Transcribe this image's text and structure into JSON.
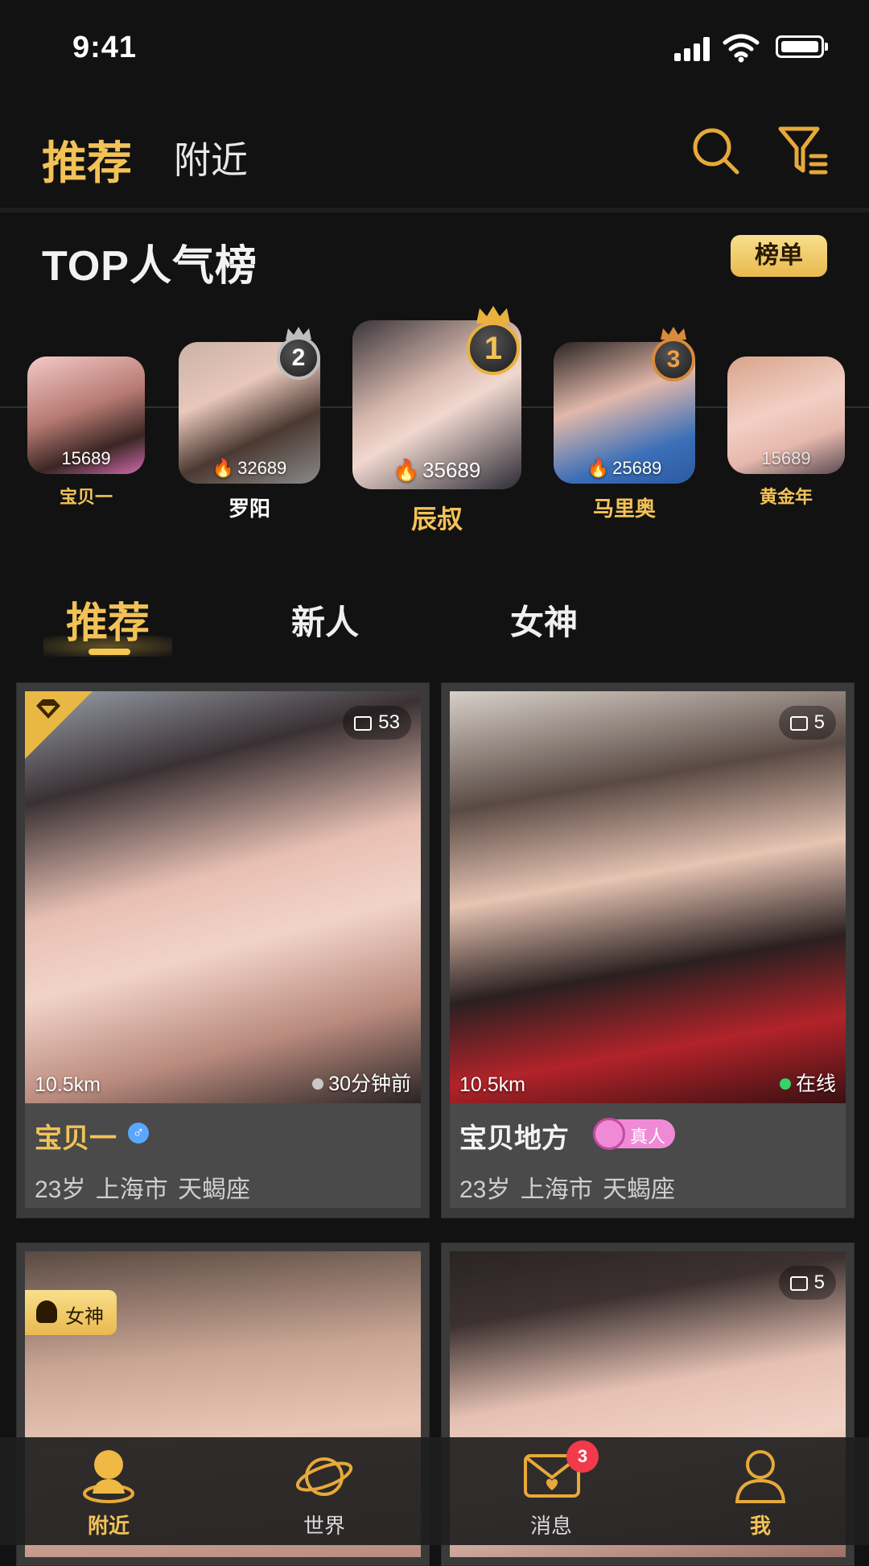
{
  "status": {
    "time": "9:41"
  },
  "topnav": {
    "active": "推荐",
    "other": "附近"
  },
  "top_section": {
    "title": "TOP人气榜",
    "rank_button": "榜单",
    "ranks": [
      {
        "name": "宝贝一",
        "count": "15689"
      },
      {
        "name": "罗阳",
        "count": "32689",
        "rank": "2"
      },
      {
        "name": "辰叔",
        "count": "35689",
        "rank": "1"
      },
      {
        "name": "马里奥",
        "count": "25689",
        "rank": "3"
      },
      {
        "name": "黄金年",
        "count": "15689"
      }
    ]
  },
  "section_tabs": [
    "推荐",
    "新人",
    "女神"
  ],
  "cards": [
    {
      "name": "宝贝一",
      "distance": "10.5km",
      "status": "30分钟前",
      "photos": "53",
      "age": "23岁",
      "city": "上海市",
      "sign": "天蝎座"
    },
    {
      "name": "宝贝地方",
      "distance": "10.5km",
      "status": "在线",
      "photos": "5",
      "badge": "真人",
      "age": "23岁",
      "city": "上海市",
      "sign": "天蝎座"
    },
    {
      "tag": "女神"
    },
    {
      "photos": "5"
    }
  ],
  "bottomnav": {
    "items": [
      "附近",
      "世界",
      "消息",
      "我"
    ],
    "message_badge": "3"
  },
  "colors": {
    "gold": "#f3c257",
    "bg": "#121212",
    "online": "#35d36b",
    "badge": "#f23a4b",
    "verify_pink": "#f08ad6"
  }
}
